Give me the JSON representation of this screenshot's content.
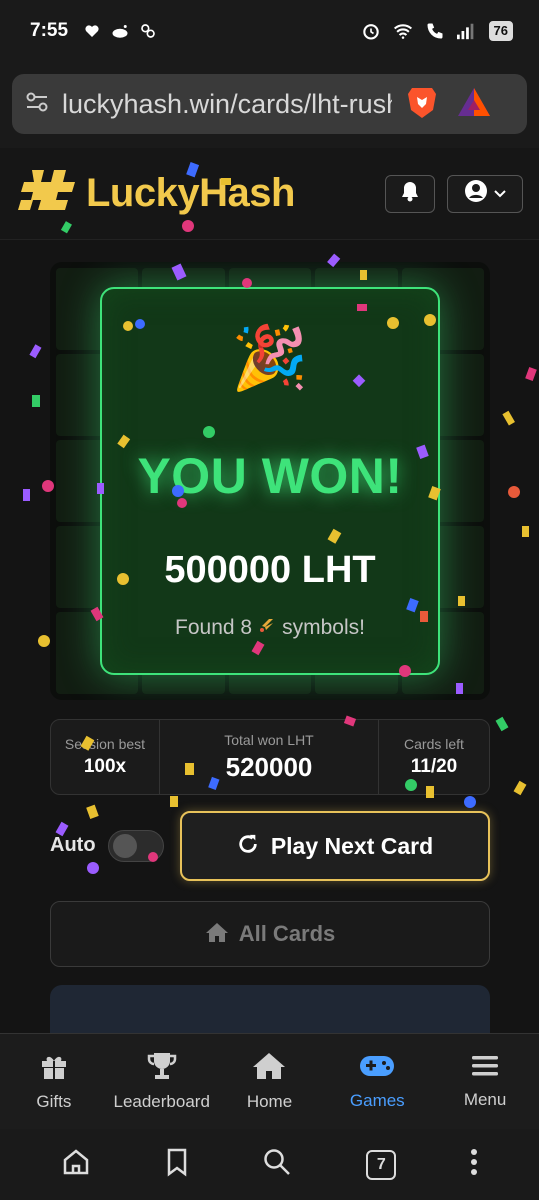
{
  "status_bar": {
    "time": "7:55",
    "battery": "76"
  },
  "browser": {
    "url": "luckyhash.win/cards/lht-rush",
    "tab_count": "7"
  },
  "site": {
    "logo_text": "LuckyHash"
  },
  "card": {
    "party_emoji": "🎉",
    "win_title": "YOU WON!",
    "win_amount": "500000 LHT",
    "found_prefix": "Found 8",
    "found_suffix": "symbols!"
  },
  "stats": [
    {
      "label": "Session best",
      "value": "100x"
    },
    {
      "label": "Total won LHT",
      "value": "520000"
    },
    {
      "label": "Cards left",
      "value": "11/20"
    }
  ],
  "controls": {
    "auto_label": "Auto",
    "auto_enabled": false,
    "play_label": "Play Next Card",
    "all_cards_label": "All Cards"
  },
  "nav": [
    {
      "label": "Gifts",
      "icon": "gift-icon"
    },
    {
      "label": "Leaderboard",
      "icon": "trophy-icon"
    },
    {
      "label": "Home",
      "icon": "home-icon"
    },
    {
      "label": "Games",
      "icon": "gamepad-icon",
      "active": true
    },
    {
      "label": "Menu",
      "icon": "menu-icon"
    }
  ],
  "colors": {
    "brand_gold": "#f2c94c",
    "win_green": "#3ee37a",
    "nav_active": "#4a9eff"
  }
}
